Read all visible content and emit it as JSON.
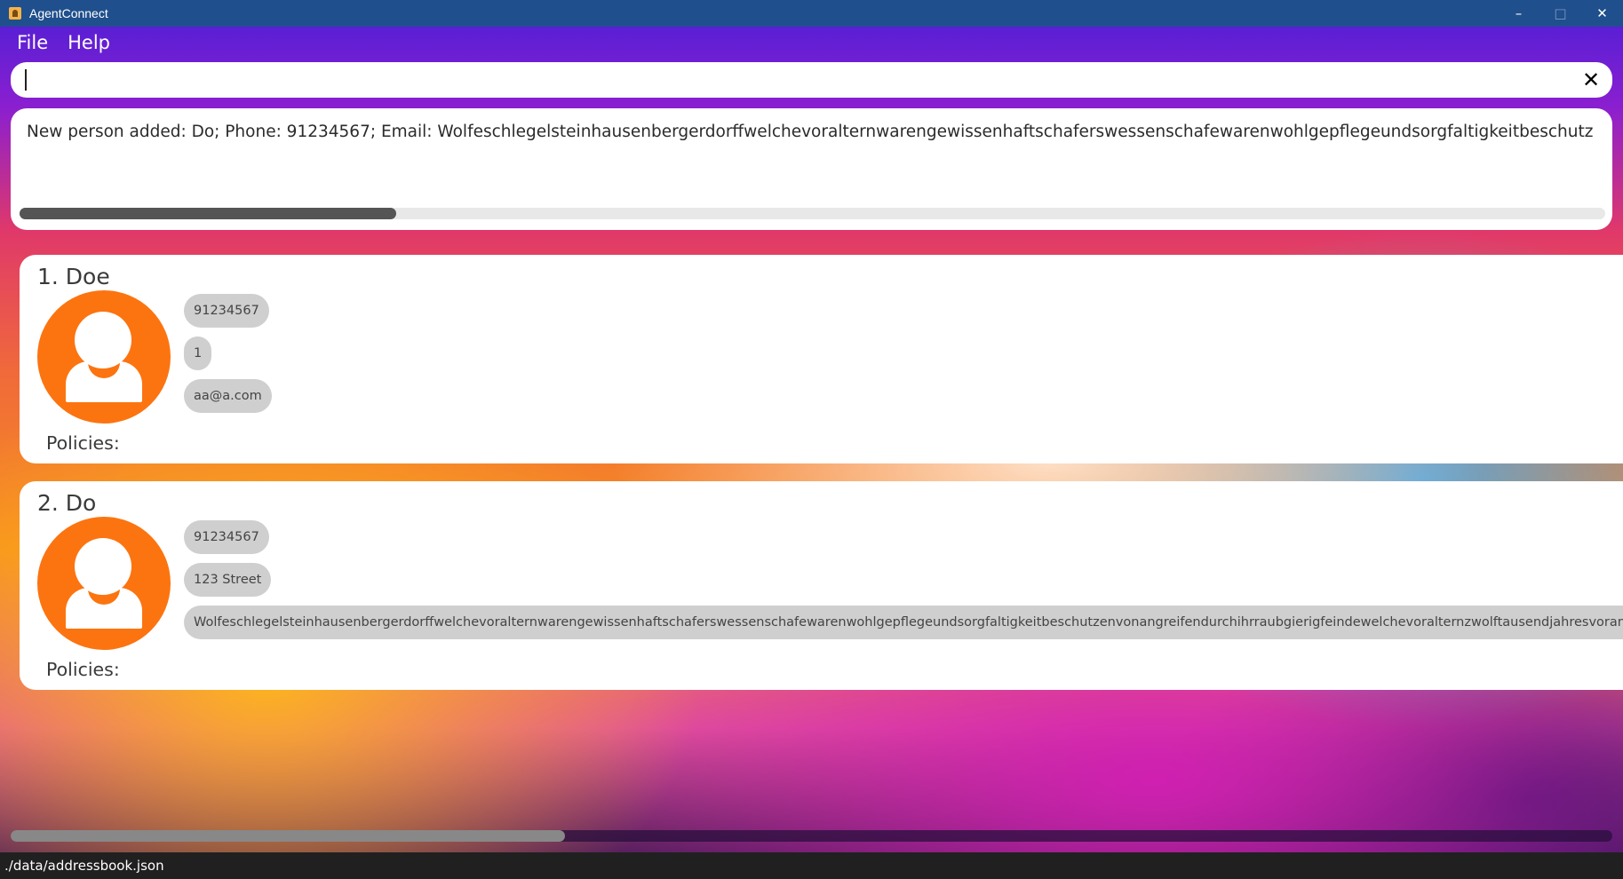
{
  "window": {
    "title": "AgentConnect",
    "controls": {
      "minimize": "–",
      "maximize": "□",
      "close": "✕"
    }
  },
  "menu": {
    "items": [
      "File",
      "Help"
    ]
  },
  "command": {
    "value": "",
    "clear_icon": "✕"
  },
  "result": {
    "text": "New person added: Do; Phone: 91234567; Email: Wolfeschlegelsteinhausenbergerdorffwelchevoralternwarengewissenhaftschaferswessenschafewarenwohlgepflegeundsorgfaltigkeitbeschutz",
    "scroll_position": 0
  },
  "persons": [
    {
      "index_name": "1. Doe",
      "phone": "91234567",
      "address": "1",
      "email": "aa@a.com",
      "policies_label": "Policies:"
    },
    {
      "index_name": "2. Do",
      "phone": "91234567",
      "address": "123 Street",
      "email": "Wolfeschlegelsteinhausenbergerdorffwelchevoralternwarengewissenhaftschaferswessenschafewarenwohlgepflegeundsorgfaltigkeitbeschutzenvonangreifendurchihrraubgierigfeindewelchevoralternzwolftausendjahresvorandieers",
      "policies_label": "Policies:"
    }
  ],
  "status": {
    "file_path": "./data/addressbook.json"
  },
  "colors": {
    "avatar": "#fc7410",
    "titlebar": "#1f4f8c",
    "tag": "#cfcfcf"
  }
}
